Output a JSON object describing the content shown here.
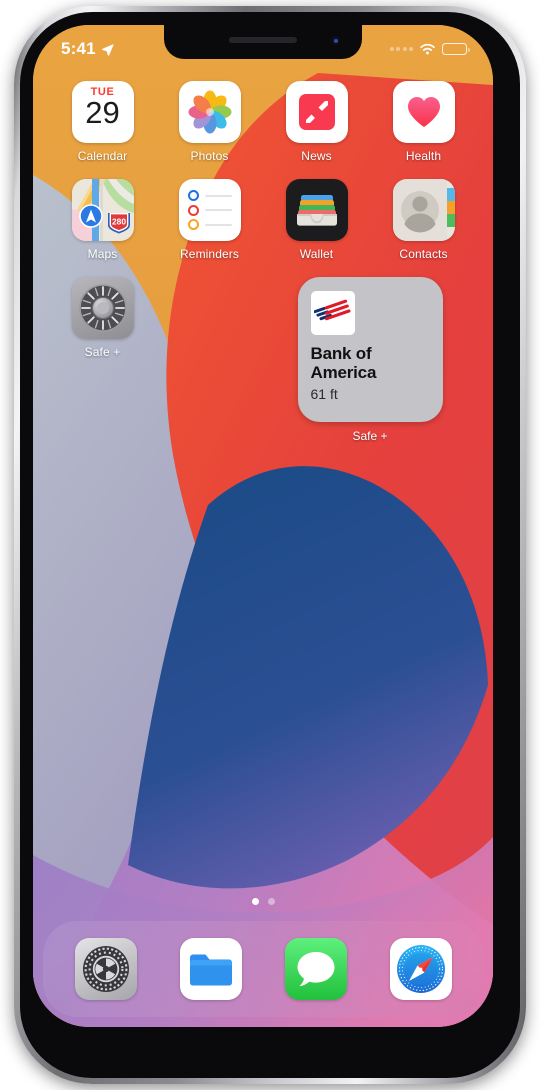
{
  "device": {
    "name": "iPhone",
    "frame": "notched-phone"
  },
  "status_bar": {
    "time": "5:41",
    "location_icon": "location-arrow-icon",
    "signal_icon": "cellular-dots-icon",
    "wifi_icon": "wifi-icon",
    "battery_icon": "battery-icon",
    "battery_level_pct": 92
  },
  "home_screen": {
    "rows": [
      [
        {
          "label": "Calendar",
          "icon": "calendar-icon",
          "weekday": "TUE",
          "day": "29"
        },
        {
          "label": "Photos",
          "icon": "photos-icon"
        },
        {
          "label": "News",
          "icon": "news-icon"
        },
        {
          "label": "Health",
          "icon": "health-icon"
        }
      ],
      [
        {
          "label": "Maps",
          "icon": "maps-icon",
          "route_badge": "280"
        },
        {
          "label": "Reminders",
          "icon": "reminders-icon"
        },
        {
          "label": "Wallet",
          "icon": "wallet-icon"
        },
        {
          "label": "Contacts",
          "icon": "contacts-icon"
        }
      ],
      [
        {
          "label": "Safe +",
          "icon": "safe-dial-icon"
        }
      ]
    ],
    "widget": {
      "app_label": "Safe +",
      "logo_icon": "bank-of-america-logo",
      "title": "Bank of America",
      "subtitle": "61 ft"
    },
    "page_dots": {
      "count": 2,
      "active_index": 0
    }
  },
  "dock": {
    "items": [
      {
        "label": "Settings",
        "icon": "settings-gear-icon"
      },
      {
        "label": "Files",
        "icon": "files-folder-icon"
      },
      {
        "label": "Messages",
        "icon": "messages-bubble-icon"
      },
      {
        "label": "Safari",
        "icon": "safari-compass-icon"
      }
    ]
  },
  "colors": {
    "wallpaper_orange": "#e8a13d",
    "wallpaper_red": "#e8453c",
    "wallpaper_blue": "#1f4f8c",
    "wallpaper_gray": "#adb6c4",
    "wallpaper_purple": "#9b7ec4",
    "wallpaper_pink": "#de80b2",
    "accent_red": "#fb3b30",
    "boa_red": "#e11b22",
    "boa_blue": "#132f6b",
    "widget_bg": "#c4c4c8"
  }
}
